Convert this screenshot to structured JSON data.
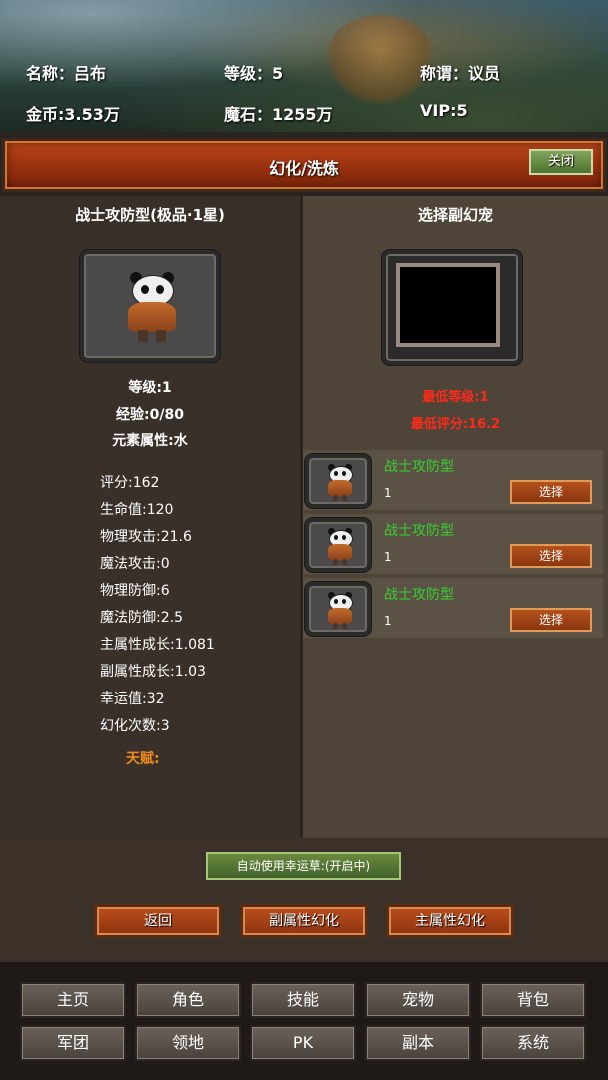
{
  "player": {
    "name_label": "名称：吕布",
    "level_label": "等级：5",
    "title_label": "称谓：议员",
    "gold_label": "金币:3.53万",
    "magic_stone_label": "魔石：1255万",
    "vip_label": "VIP:5"
  },
  "header": {
    "title": "幻化/洗炼",
    "close_label": "关闭"
  },
  "pet": {
    "name": "战士攻防型(极品·1星)",
    "level": "等级:1",
    "exp": "经验:0/80",
    "element": "元素属性:水",
    "stats": [
      "评分:162",
      "生命值:120",
      "物理攻击:21.6",
      "魔法攻击:0",
      "物理防御:6",
      "魔法防御:2.5",
      "主属性成长:1.081",
      "副属性成长:1.03",
      "幸运值:32",
      "幻化次数:3"
    ],
    "talent_label": "天赋:"
  },
  "secondary": {
    "title": "选择副幻宠",
    "min_level": "最低等级:1",
    "min_score": "最低评分:16.2",
    "candidates": [
      {
        "name": "战士攻防型",
        "level": "1",
        "button": "选择"
      },
      {
        "name": "战士攻防型",
        "level": "1",
        "button": "选择"
      },
      {
        "name": "战士攻防型",
        "level": "1",
        "button": "选择"
      }
    ]
  },
  "actions": {
    "lucky_toggle": "自动使用幸运草:(开启中)",
    "back": "返回",
    "secondary_morph": "副属性幻化",
    "primary_morph": "主属性幻化"
  },
  "nav": {
    "items": [
      "主页",
      "角色",
      "技能",
      "宠物",
      "背包",
      "军团",
      "领地",
      "PK",
      "副本",
      "系统"
    ]
  },
  "colors": {
    "green_text": "#37d12e",
    "red_text": "#ff2a1a",
    "orange_text": "#f08a1a"
  }
}
